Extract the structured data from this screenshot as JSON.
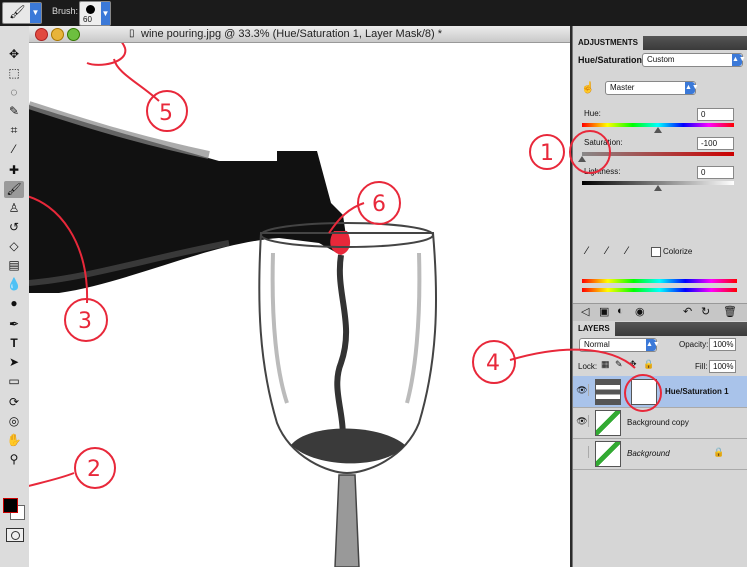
{
  "options_bar": {
    "brush_label": "Brush:",
    "brush_size": "60"
  },
  "document": {
    "title": "wine pouring.jpg @ 33.3% (Hue/Saturation 1, Layer Mask/8) *"
  },
  "adjustments": {
    "tab": "ADJUSTMENTS",
    "panel_title": "Hue/Saturation",
    "preset": "Custom",
    "channel": "Master",
    "hue_label": "Hue:",
    "hue_value": "0",
    "saturation_label": "Saturation:",
    "saturation_value": "-100",
    "lightness_label": "Lightness:",
    "lightness_value": "0",
    "colorize_label": "Colorize",
    "sliders": {
      "hue": 0,
      "saturation": -100,
      "lightness": 0
    }
  },
  "layers": {
    "tab": "LAYERS",
    "blend_mode": "Normal",
    "opacity_label": "Opacity:",
    "opacity_value": "100%",
    "lock_label": "Lock:",
    "fill_label": "Fill:",
    "fill_value": "100%",
    "items": [
      {
        "name": "Hue/Saturation 1"
      },
      {
        "name": "Background copy"
      },
      {
        "name": "Background"
      }
    ]
  },
  "annotations": [
    "1",
    "2",
    "3",
    "4",
    "5",
    "6"
  ],
  "colors": {
    "annotation": "#e8283a",
    "wine": "#e8283a",
    "accent": "#3b79d8"
  }
}
